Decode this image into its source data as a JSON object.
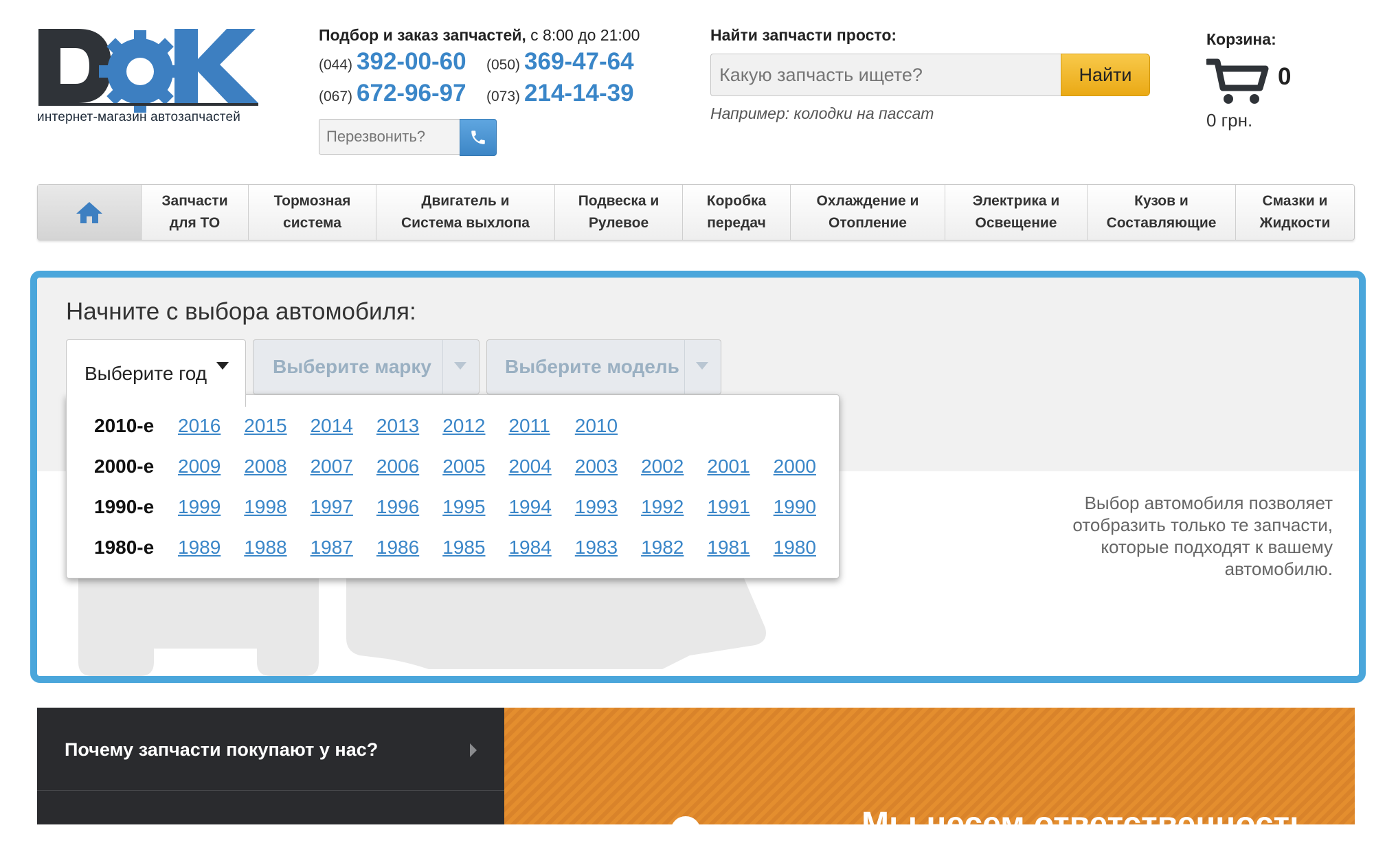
{
  "logo": {
    "text": "DOK",
    "tagline": "интернет-магазин автозапчастей"
  },
  "contacts": {
    "title_bold": "Подбор и заказ запчастей,",
    "title_hours": "с 8:00 до 21:00",
    "phones": [
      {
        "code": "(044)",
        "number": "392-00-60"
      },
      {
        "code": "(050)",
        "number": "369-47-64"
      },
      {
        "code": "(067)",
        "number": "672-96-97"
      },
      {
        "code": "(073)",
        "number": "214-14-39"
      }
    ],
    "callback_placeholder": "Перезвонить?"
  },
  "search": {
    "title": "Найти запчасти просто:",
    "placeholder": "Какую запчасть ищете?",
    "button": "Найти",
    "example": "Например: колодки на пассат"
  },
  "cart": {
    "title": "Корзина:",
    "count": "0",
    "sum": "0 грн."
  },
  "nav": {
    "items": [
      {
        "line1": "Запчасти",
        "line2": "для ТО"
      },
      {
        "line1": "Тормозная",
        "line2": "система"
      },
      {
        "line1": "Двигатель и",
        "line2": "Система выхлопа"
      },
      {
        "line1": "Подвеска и",
        "line2": "Рулевое"
      },
      {
        "line1": "Коробка",
        "line2": "передач"
      },
      {
        "line1": "Охлаждение и",
        "line2": "Отопление"
      },
      {
        "line1": "Электрика и",
        "line2": "Освещение"
      },
      {
        "line1": "Кузов и",
        "line2": "Составляющие"
      },
      {
        "line1": "Смазки и",
        "line2": "Жидкости"
      }
    ]
  },
  "selector": {
    "title": "Начните с выбора автомобиля:",
    "year_label": "Выберите год",
    "brand_label": "Выберите марку",
    "model_label": "Выберите модель",
    "decades": [
      {
        "label": "2010-е",
        "years": [
          "2016",
          "2015",
          "2014",
          "2013",
          "2012",
          "2011",
          "2010"
        ]
      },
      {
        "label": "2000-е",
        "years": [
          "2009",
          "2008",
          "2007",
          "2006",
          "2005",
          "2004",
          "2003",
          "2002",
          "2001",
          "2000"
        ]
      },
      {
        "label": "1990-е",
        "years": [
          "1999",
          "1998",
          "1997",
          "1996",
          "1995",
          "1994",
          "1993",
          "1992",
          "1991",
          "1990"
        ]
      },
      {
        "label": "1980-е",
        "years": [
          "1989",
          "1988",
          "1987",
          "1986",
          "1985",
          "1984",
          "1983",
          "1982",
          "1981",
          "1980"
        ]
      }
    ],
    "hint_lines": [
      "Выбор автомобиля позволяет",
      "отобразить только те запчасти,",
      "которые подходят к вашему",
      "автомобилю."
    ]
  },
  "bottom": {
    "why_title": "Почему запчасти покупают у нас?",
    "promo_text": "Мы несем ответственность"
  },
  "colors": {
    "accent_blue": "#3a86c8",
    "frame_blue": "#4aa6db",
    "button_yellow": "#f2b92c",
    "promo_orange": "#e48e2e"
  }
}
